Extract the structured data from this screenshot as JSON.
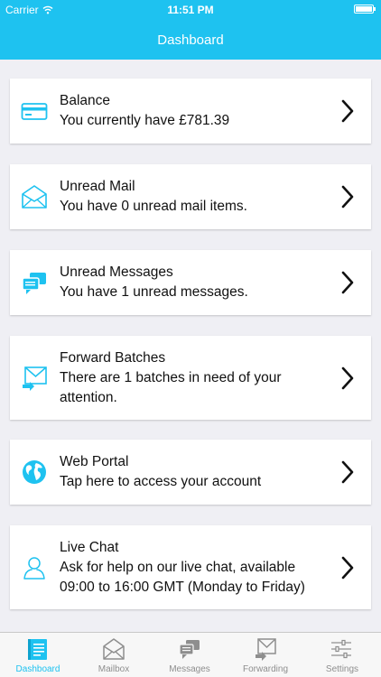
{
  "status_bar": {
    "carrier": "Carrier",
    "time": "11:51 PM"
  },
  "header": {
    "title": "Dashboard"
  },
  "cards": [
    {
      "title": "Balance",
      "text": "You currently have £781.39",
      "icon": "credit-card-icon"
    },
    {
      "title": "Unread Mail",
      "text": "You have 0 unread mail items.",
      "icon": "mail-icon"
    },
    {
      "title": "Unread Messages",
      "text": "You have 1 unread messages.",
      "icon": "chat-bubbles-icon"
    },
    {
      "title": "Forward Batches",
      "text": "There are 1 batches in need of your attention.",
      "icon": "forward-mail-icon"
    },
    {
      "title": "Web Portal",
      "text": "Tap here to access your account",
      "icon": "globe-icon"
    },
    {
      "title": "Live Chat",
      "text": "Ask for help on our live chat, available 09:00 to 16:00 GMT (Monday to Friday)",
      "icon": "person-icon"
    }
  ],
  "tabs": [
    {
      "label": "Dashboard",
      "icon": "dashboard-icon",
      "active": true
    },
    {
      "label": "Mailbox",
      "icon": "mailbox-icon",
      "active": false
    },
    {
      "label": "Messages",
      "icon": "messages-icon",
      "active": false
    },
    {
      "label": "Forwarding",
      "icon": "forwarding-icon",
      "active": false
    },
    {
      "label": "Settings",
      "icon": "settings-icon",
      "active": false
    }
  ],
  "colors": {
    "accent": "#1ec2f0",
    "background": "#efeff4",
    "tab_inactive": "#8e8e8e"
  }
}
